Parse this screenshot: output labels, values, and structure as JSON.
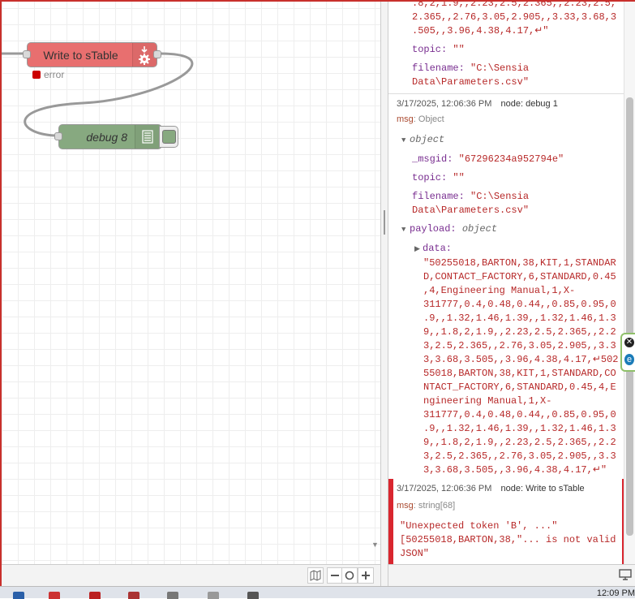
{
  "workspace": {
    "write_node_label": "Write to sTable",
    "write_node_status": "error",
    "debug_node_label": "debug 8"
  },
  "sidebar": {
    "top_entry": {
      "lines": [
        ".8,2,1.9,,2.23,2.5,2.365,,2.23,2.5,",
        "2.365,,2.76,3.05,2.905,,3.33,3.68,3",
        ".505,,3.96,4.38,4.17,↵\""
      ],
      "topic_key": "topic:",
      "topic_val": "\"\"",
      "filename_key": "filename:",
      "filename_line1": "\"C:\\Sensia",
      "filename_line2": "Data\\Parameters.csv\""
    },
    "debug1_entry": {
      "timestamp": "3/17/2025, 12:06:36 PM",
      "node": "node: debug 1",
      "msg_label": "msg",
      "msg_type": ": Object",
      "object_label": "object",
      "msgid_key": "_msgid:",
      "msgid_val": "\"67296234a952794e\"",
      "topic_key": "topic:",
      "topic_val": "\"\"",
      "filename_key": "filename:",
      "filename_line1": "\"C:\\Sensia",
      "filename_line2": "Data\\Parameters.csv\"",
      "payload_key": "payload:",
      "payload_type": "object",
      "data_key": "data:",
      "data_lines": [
        "\"50255018,BARTON,38,KIT,1,STANDAR",
        "D,CONTACT_FACTORY,6,STANDARD,0.45",
        ",4,Engineering Manual,1,X-",
        "311777,0.4,0.48,0.44,,0.85,0.95,0",
        ".9,,1.32,1.46,1.39,,1.32,1.46,1.3",
        "9,,1.8,2,1.9,,2.23,2.5,2.365,,2.2",
        "3,2.5,2.365,,2.76,3.05,2.905,,3.3",
        "3,3.68,3.505,,3.96,4.38,4.17,↵502",
        "55018,BARTON,38,KIT,1,STANDARD,CO",
        "NTACT_FACTORY,6,STANDARD,0.45,4,E",
        "ngineering Manual,1,X-",
        "311777,0.4,0.48,0.44,,0.85,0.95,0",
        ".9,,1.32,1.46,1.39,,1.32,1.46,1.3",
        "9,,1.8,2,1.9,,2.23,2.5,2.365,,2.2",
        "3,2.5,2.365,,2.76,3.05,2.905,,3.3",
        "3,3.68,3.505,,3.96,4.38,4.17,↵\""
      ]
    },
    "error_entry": {
      "timestamp": "3/17/2025, 12:06:36 PM",
      "node": "node: Write to sTable",
      "msg_label": "msg",
      "msg_type": ": string[68]",
      "lines": [
        "\"Unexpected token 'B', ...\"",
        "[50255018,BARTON,38,\"... is not valid",
        "JSON\""
      ]
    }
  },
  "side_tab": {
    "close_glyph": "✕",
    "edge_glyph": "e"
  },
  "taskbar": {
    "clock": "12:09 PM"
  },
  "colors": {
    "error_red": "#d9262f",
    "node_red": "#e86f6f",
    "debug_green": "#87a980"
  }
}
